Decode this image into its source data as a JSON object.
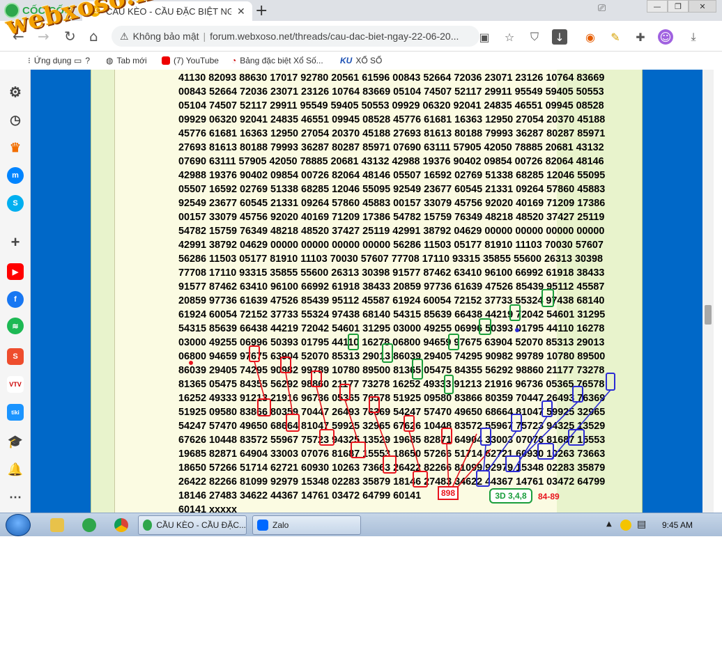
{
  "browser": {
    "brand": "CỐC CỐC",
    "tab": {
      "title": "CẦU KÈO - CẦU ĐẶC BIỆT NG",
      "favicon": "XS"
    },
    "address": {
      "security": "Không bảo mật",
      "url": "forum.webxoso.net/threads/cau-dac-biet-ngay-22-06-20..."
    },
    "bookmarks": [
      {
        "label": "Ứng dụng",
        "icon": "apps-icon"
      },
      {
        "label": "?",
        "icon": "folder-icon"
      },
      {
        "label": "Tab mới",
        "icon": "globe-icon"
      },
      {
        "label": "(7) YouTube",
        "icon": "youtube-icon"
      },
      {
        "label": "Bảng đặc biệt Xổ Số...",
        "icon": "xoso-icon"
      },
      {
        "label": "XỔ SỐ",
        "icon": "ku-icon"
      }
    ],
    "watermark": "webxoso.net"
  },
  "page": {
    "top_right_partial": "41130 82093 88630 17017 92780 20561 61596",
    "lines": [
      "41130 82093 88630 17017 92780 20561 61596 00843 52664 72036 23071 23126 10764 83669",
      "00843 52664 72036 23071 23126 10764 83669 05104 74507 52117 29911 95549 59405 50553",
      "05104 74507 52117 29911 95549 59405 50553 09929 06320 92041 24835 46551 09945 08528",
      "09929 06320 92041 24835 46551 09945 08528 45776 61681 16363 12950 27054 20370 45188",
      "45776 61681 16363 12950 27054 20370 45188 27693 81613 80188 79993 36287 80287 85971",
      "27693 81613 80188 79993 36287 80287 85971 07690 63111 57905 42050 78885 20681 43132",
      "07690 63111 57905 42050 78885 20681 43132 42988 19376 90402 09854 00726 82064 48146",
      "42988 19376 90402 09854 00726 82064 48146 05507 16592 02769 51338 68285 12046 55095",
      "05507 16592 02769 51338 68285 12046 55095 92549 23677 60545 21331 09264 57860 45883",
      "92549 23677 60545 21331 09264 57860 45883 00157 33079 45756 92020 40169 71209 17386",
      "00157 33079 45756 92020 40169 71209 17386 54782 15759 76349 48218 48520 37427 25119",
      "54782 15759 76349 48218 48520 37427 25119 42991 38792 04629 00000 00000 00000 00000",
      "42991 38792 04629 00000 00000 00000 00000 56286 11503 05177 81910 11103 70030 57607",
      "56286 11503 05177 81910 11103 70030 57607 77708 17110 93315 35855 55600 26313 30398",
      "77708 17110 93315 35855 55600 26313 30398 91577 87462 63410 96100 66992 61918 38433",
      "91577 87462 63410 96100 66992 61918 38433 20859 97736 61639 47526 85439 95112 45587",
      "20859 97736 61639 47526 85439 95112 45587 61924 60054 72152 37733 55324 97438 68140",
      "61924 60054 72152 37733 55324 97438 68140 54315 85639 66438 44219 72042 54601 31295",
      "54315 85639 66438 44219 72042 54601 31295 03000 49255 06996 50393 01795 44110 16278",
      "03000 49255 06996 50393 01795 44110 16278 06800 94659 97675 63904 52070 85313 29013",
      "06800 94659 97675 63904 52070 85313 29013 86039 29405 74295 90982 99789 10780 89500",
      "86039 29405 74295 90982 99789 10780 89500 81365 05475 84355 56292 98860 21177 73278",
      "81365 05475 84355 56292 98860 21177 73278 16252 49333 91213 21916 96736 05365 76578",
      "16252 49333 91213 21916 96736 05365 76578 51925 09580 83866 80359 70447 26493 76369",
      "51925 09580 83866 80359 70447 26493 76369 54247 57470 49650 68664 81047 59925 32965",
      "54247 57470 49650 68664 81047 59925 32965 67626 10448 83572 55967 75723 94325 13529",
      "67626 10448 83572 55967 75723 94325 13529 19685 82871 64904 33003 07076 81687 15553",
      "19685 82871 64904 33003 07076 81687 15553 18650 57266 51714 62721 60930 10263 73663",
      "18650 57266 51714 62721 60930 10263 73663 26422 82266 81099 92979 15348 02283 35879",
      "26422 82266 81099 92979 15348 02283 35879 18146 27483 34622 44367 14761 03472 64799",
      "18146 27483 34622 44367 14761 03472 64799 60141",
      "60141 xxxxx"
    ],
    "annotations": {
      "result_red": "898",
      "result_green": "3D 3,4,8",
      "result_pair": "84-89",
      "colors": {
        "red": "#e8141d",
        "green": "#1a9e3c",
        "blue": "#2b2bd4"
      }
    }
  },
  "taskbar": {
    "tasks": [
      {
        "label": "CẦU KÈO - CẦU ĐẶC...",
        "icon": "coccoc-icon"
      },
      {
        "label": "Zalo",
        "icon": "zalo-icon"
      }
    ],
    "clock": "9:45 AM"
  }
}
